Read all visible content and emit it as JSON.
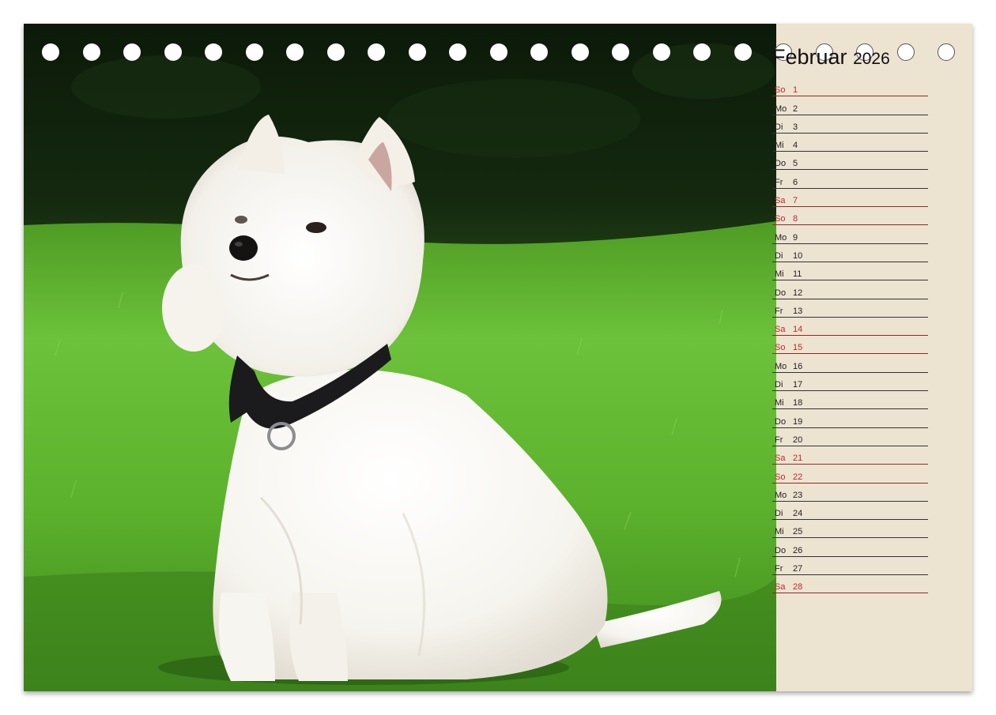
{
  "calendar": {
    "month": "Februar",
    "year": "2026",
    "days": [
      {
        "wd": "So",
        "d": "1",
        "weekend": true
      },
      {
        "wd": "Mo",
        "d": "2",
        "weekend": false
      },
      {
        "wd": "Di",
        "d": "3",
        "weekend": false
      },
      {
        "wd": "Mi",
        "d": "4",
        "weekend": false
      },
      {
        "wd": "Do",
        "d": "5",
        "weekend": false
      },
      {
        "wd": "Fr",
        "d": "6",
        "weekend": false
      },
      {
        "wd": "Sa",
        "d": "7",
        "weekend": true
      },
      {
        "wd": "So",
        "d": "8",
        "weekend": true
      },
      {
        "wd": "Mo",
        "d": "9",
        "weekend": false
      },
      {
        "wd": "Di",
        "d": "10",
        "weekend": false
      },
      {
        "wd": "Mi",
        "d": "11",
        "weekend": false
      },
      {
        "wd": "Do",
        "d": "12",
        "weekend": false
      },
      {
        "wd": "Fr",
        "d": "13",
        "weekend": false
      },
      {
        "wd": "Sa",
        "d": "14",
        "weekend": true
      },
      {
        "wd": "So",
        "d": "15",
        "weekend": true
      },
      {
        "wd": "Mo",
        "d": "16",
        "weekend": false
      },
      {
        "wd": "Di",
        "d": "17",
        "weekend": false
      },
      {
        "wd": "Mi",
        "d": "18",
        "weekend": false
      },
      {
        "wd": "Do",
        "d": "19",
        "weekend": false
      },
      {
        "wd": "Fr",
        "d": "20",
        "weekend": false
      },
      {
        "wd": "Sa",
        "d": "21",
        "weekend": true
      },
      {
        "wd": "So",
        "d": "22",
        "weekend": true
      },
      {
        "wd": "Mo",
        "d": "23",
        "weekend": false
      },
      {
        "wd": "Di",
        "d": "24",
        "weekend": false
      },
      {
        "wd": "Mi",
        "d": "25",
        "weekend": false
      },
      {
        "wd": "Do",
        "d": "26",
        "weekend": false
      },
      {
        "wd": "Fr",
        "d": "27",
        "weekend": false
      },
      {
        "wd": "Sa",
        "d": "28",
        "weekend": true
      }
    ]
  },
  "colors": {
    "panel_background": "#ede3d1",
    "weekend_text": "#c0282d",
    "lawn_green": "#5fb82f",
    "hedge_dark": "#0f1f0b"
  },
  "photo": {
    "subject": "west-highland-white-terrier-icon"
  }
}
